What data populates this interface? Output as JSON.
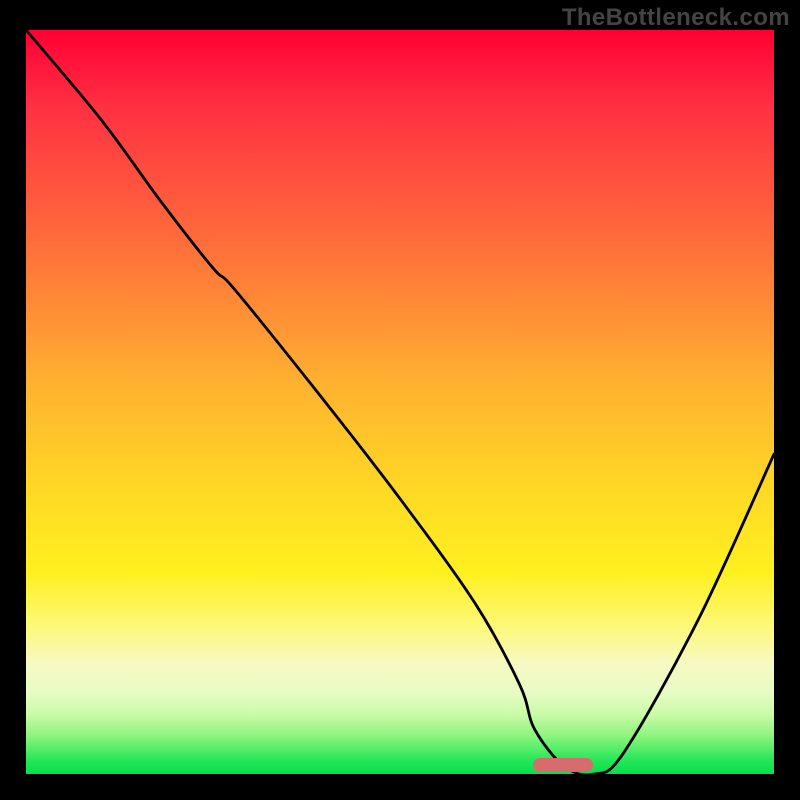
{
  "watermark": "TheBottleneck.com",
  "colors": {
    "curve_stroke": "#000000",
    "marker_fill": "#d76b6d",
    "background": "#000000"
  },
  "chart_data": {
    "type": "line",
    "title": "",
    "xlabel": "",
    "ylabel": "",
    "xlim": [
      0,
      100
    ],
    "ylim": [
      0,
      100
    ],
    "grid": false,
    "legend": false,
    "series": [
      {
        "name": "bottleneck-curve",
        "x": [
          0,
          10,
          18,
          25,
          28,
          40,
          50,
          60,
          66,
          68,
          72,
          76,
          80,
          90,
          100
        ],
        "values": [
          100,
          88,
          77,
          68,
          65,
          50,
          37,
          23,
          12,
          6,
          1,
          0,
          3,
          21,
          43
        ]
      }
    ],
    "marker": {
      "x_start": 68,
      "x_end": 76,
      "y": 0
    },
    "gradient_stops": [
      {
        "pct": 0,
        "color": "#ff0033"
      },
      {
        "pct": 28,
        "color": "#ff6b3b"
      },
      {
        "pct": 62,
        "color": "#ffd924"
      },
      {
        "pct": 85,
        "color": "#f7f9c2"
      },
      {
        "pct": 98,
        "color": "#28e85a"
      },
      {
        "pct": 100,
        "color": "#06de4d"
      }
    ]
  }
}
